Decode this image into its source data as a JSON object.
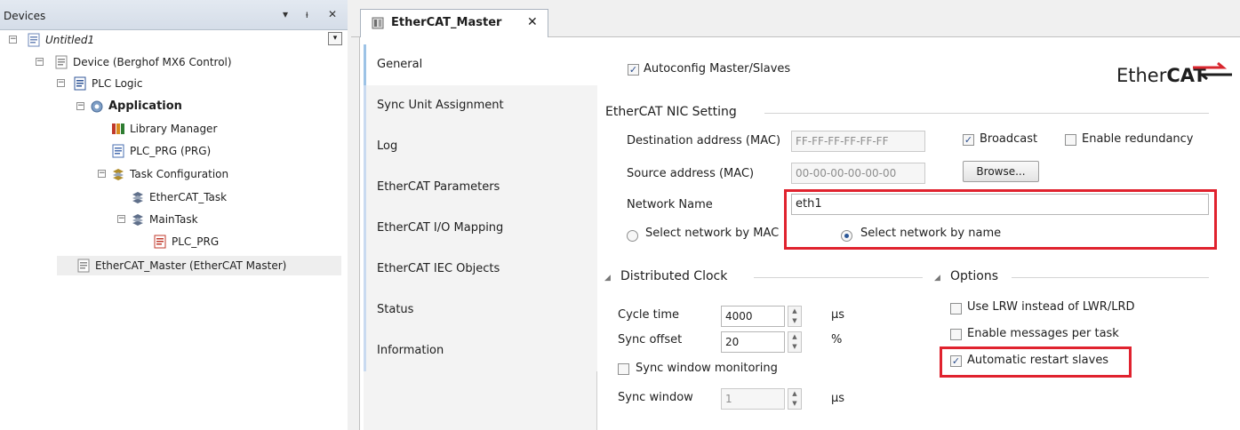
{
  "devices_panel": {
    "title": "Devices",
    "header_buttons": {
      "menu": "▾",
      "pin": "ᵼ",
      "close": "✕"
    },
    "dropdown_glyph": "▾",
    "tree": [
      {
        "label": "Untitled1",
        "italic": true,
        "icon": "project-icon"
      },
      {
        "label": "Device (Berghof MX6 Control)",
        "icon": "device-icon"
      },
      {
        "label": "PLC Logic",
        "icon": "plc-logic-icon"
      },
      {
        "label": "Application",
        "bold": true,
        "icon": "application-gear-icon"
      },
      {
        "label": "Library Manager",
        "icon": "library-books-icon"
      },
      {
        "label": "PLC_PRG (PRG)",
        "icon": "program-icon"
      },
      {
        "label": "Task Configuration",
        "icon": "task-config-icon"
      },
      {
        "label": "EtherCAT_Task",
        "icon": "task-icon"
      },
      {
        "label": "MainTask",
        "icon": "task-icon"
      },
      {
        "label": "PLC_PRG",
        "icon": "program-call-icon"
      },
      {
        "label": "EtherCAT_Master (EtherCAT Master)",
        "icon": "device-icon"
      }
    ]
  },
  "editor": {
    "tab_label": "EtherCAT_Master",
    "tab_close": "✕",
    "vertical_tabs": [
      "General",
      "Sync Unit Assignment",
      "Log",
      "EtherCAT Parameters",
      "EtherCAT I/O Mapping",
      "EtherCAT IEC Objects",
      "Status",
      "Information"
    ],
    "active_tab": "General",
    "general": {
      "autoconfig": {
        "label": "Autoconfig Master/Slaves",
        "checked": true
      },
      "logo": {
        "text_plain": "Ether",
        "text_bold": "CAT"
      },
      "nic_section": "EtherCAT NIC Setting",
      "destination_label": "Destination address (MAC)",
      "destination_value": "FF-FF-FF-FF-FF-FF",
      "broadcast": {
        "label": "Broadcast",
        "checked": true
      },
      "redundancy": {
        "label": "Enable redundancy",
        "checked": false
      },
      "source_label": "Source address (MAC)",
      "source_value": "00-00-00-00-00-00",
      "browse_label": "Browse...",
      "network_name_label": "Network Name",
      "network_name_value": "eth1",
      "radio_mac": {
        "label": "Select network by MAC",
        "selected": false
      },
      "radio_name": {
        "label": "Select network by name",
        "selected": true
      },
      "dc_section": "Distributed Clock",
      "cycle_time_label": "Cycle time",
      "cycle_time_value": "4000",
      "cycle_time_unit": "µs",
      "sync_offset_label": "Sync offset",
      "sync_offset_value": "20",
      "sync_offset_unit": "%",
      "sync_window_monitoring": {
        "label": "Sync window monitoring",
        "checked": false
      },
      "sync_window_label": "Sync window",
      "sync_window_value": "1",
      "sync_window_unit": "µs",
      "options_section": "Options",
      "use_lrw": {
        "label": "Use LRW instead of LWR/LRD",
        "checked": false
      },
      "messages_per_task": {
        "label": "Enable messages per task",
        "checked": false
      },
      "auto_restart": {
        "label": "Automatic restart slaves",
        "checked": true
      },
      "collapse_glyph": "◢"
    },
    "highlight_color": "#e0222e"
  }
}
